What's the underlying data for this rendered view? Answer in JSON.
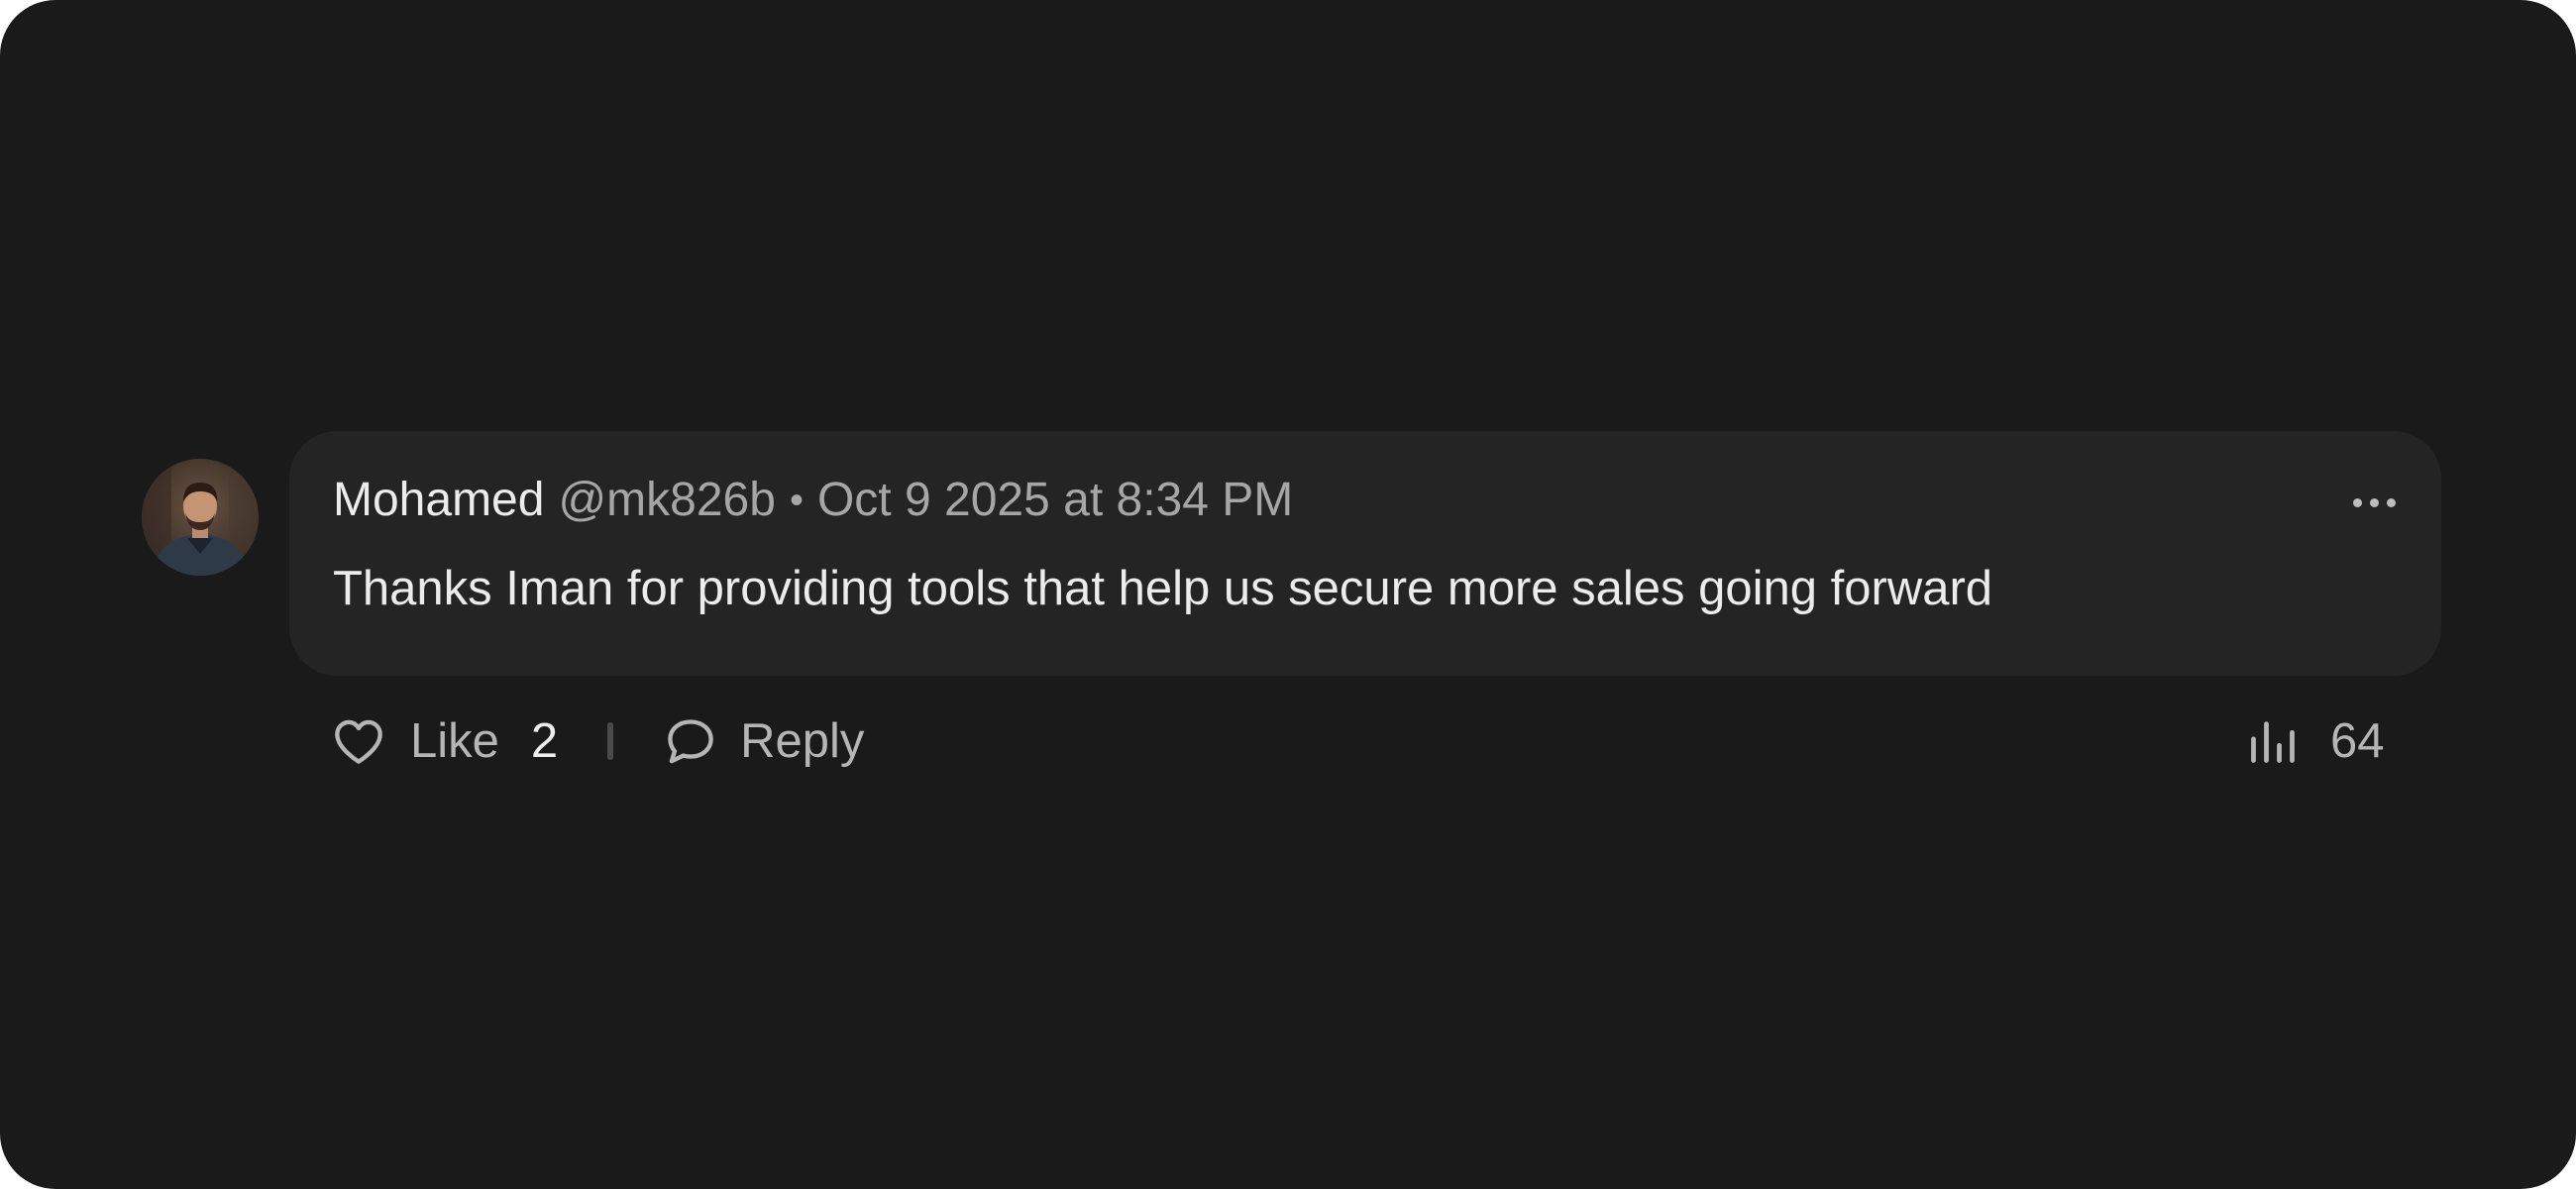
{
  "comment": {
    "author": "Mohamed",
    "handle": "@mk826b",
    "separator": "•",
    "timestamp": "Oct 9 2025 at 8:34 PM",
    "text": "Thanks Iman for providing tools that help us secure more sales going forward"
  },
  "actions": {
    "like_label": "Like",
    "like_count": "2",
    "reply_label": "Reply",
    "views_count": "64"
  },
  "icons": {
    "more": "more-horizontal-icon",
    "like": "heart-icon",
    "reply": "speech-bubble-icon",
    "views": "bar-chart-icon"
  },
  "colors": {
    "background": "#1a1a1a",
    "bubble": "#242424",
    "primary_text": "#ececec",
    "secondary_text": "#a6a6a6"
  }
}
